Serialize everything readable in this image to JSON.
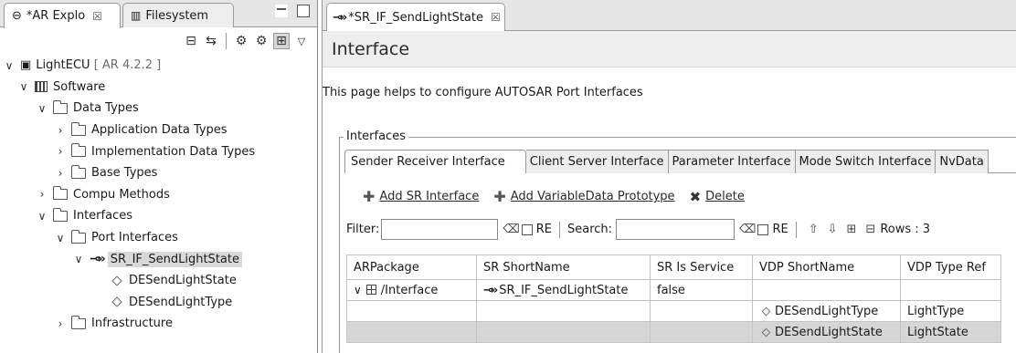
{
  "left_panel": {
    "tabs": [
      {
        "label": "*AR Explo",
        "close": "☒"
      },
      {
        "label": "Filesystem"
      }
    ],
    "tree": {
      "root": {
        "label": "LightECU",
        "version": "[ AR 4.2.2 ]"
      },
      "software": "Software",
      "data_types": "Data Types",
      "application_data_types": "Application Data Types",
      "implementation_data_types": "Implementation Data Types",
      "base_types": "Base Types",
      "compu_methods": "Compu Methods",
      "interfaces": "Interfaces",
      "port_interfaces": "Port Interfaces",
      "sr_interface": "SR_IF_SendLightState",
      "element_1": "DESendLightState",
      "element_2": "DESendLightType",
      "infrastructure": "Infrastructure"
    }
  },
  "editor": {
    "tab_label": "*SR_IF_SendLightState",
    "tab_close": "☒",
    "header": "Interface",
    "description": "This page helps to configure AUTOSAR Port Interfaces",
    "group_label": "Interfaces",
    "subtabs": [
      "Sender Receiver Interface",
      "Client Server Interface",
      "Parameter Interface",
      "Mode Switch Interface",
      "NvData"
    ],
    "actions": {
      "add_sr": "Add SR Interface",
      "add_vdp": "Add VariableData Prototype",
      "delete": "Delete"
    },
    "filter": {
      "filter_label": "Filter:",
      "re_label": "RE",
      "search_label": "Search:",
      "rows_label": "Rows : 3"
    },
    "table": {
      "headers": [
        "ARPackage",
        "SR ShortName",
        "SR Is Service",
        "VDP ShortName",
        "VDP Type Ref"
      ],
      "row1": {
        "package": "/Interface",
        "sr_shortname": "SR_IF_SendLightState",
        "is_service": "false"
      },
      "row2": {
        "vdp_shortname": "DESendLightType",
        "vdp_typeref": "LightType"
      },
      "row3": {
        "vdp_shortname": "DESendLightState",
        "vdp_typeref": "LightState"
      }
    }
  }
}
